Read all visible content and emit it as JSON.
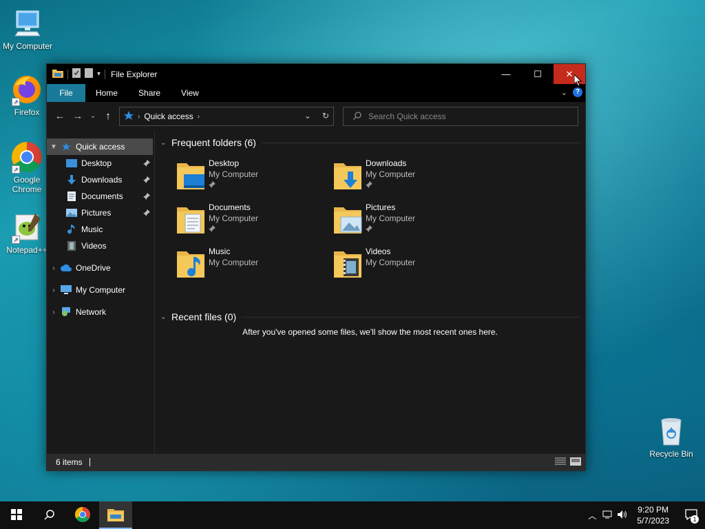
{
  "desktop": {
    "icons": [
      {
        "label": "My Computer"
      },
      {
        "label": "Firefox"
      },
      {
        "label": "Google Chrome"
      },
      {
        "label": "Notepad++"
      },
      {
        "label": "Recycle Bin"
      }
    ]
  },
  "window": {
    "title": "File Explorer",
    "controls": {
      "minimize": "—",
      "maximize": "☐",
      "close": "✕"
    },
    "ribbon": {
      "tabs": [
        "File",
        "Home",
        "Share",
        "View"
      ],
      "help": "?"
    },
    "address": {
      "crumb": "Quick access"
    },
    "search": {
      "placeholder": "Search Quick access"
    },
    "nav": {
      "items": [
        {
          "label": "Quick access"
        },
        {
          "label": "Desktop"
        },
        {
          "label": "Downloads"
        },
        {
          "label": "Documents"
        },
        {
          "label": "Pictures"
        },
        {
          "label": "Music"
        },
        {
          "label": "Videos"
        },
        {
          "label": "OneDrive"
        },
        {
          "label": "My Computer"
        },
        {
          "label": "Network"
        }
      ]
    },
    "frequent": {
      "title": "Frequent folders (6)",
      "folders": [
        {
          "name": "Desktop",
          "location": "My Computer"
        },
        {
          "name": "Downloads",
          "location": "My Computer"
        },
        {
          "name": "Documents",
          "location": "My Computer"
        },
        {
          "name": "Pictures",
          "location": "My Computer"
        },
        {
          "name": "Music",
          "location": "My Computer"
        },
        {
          "name": "Videos",
          "location": "My Computer"
        }
      ]
    },
    "recent": {
      "title": "Recent files (0)",
      "empty_message": "After you've opened some files, we'll show the most recent ones here."
    },
    "status": {
      "items": "6 items"
    }
  },
  "taskbar": {
    "clock": {
      "time": "9:20 PM",
      "date": "5/7/2023"
    },
    "notifications": "1"
  },
  "colors": {
    "accent": "#1a7a99",
    "close": "#c42b1c",
    "folder": "#f5c85a"
  }
}
